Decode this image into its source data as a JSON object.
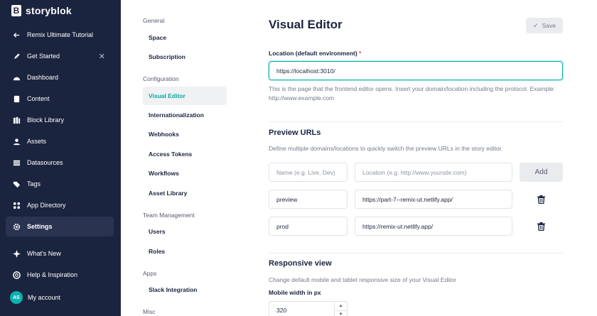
{
  "brand": {
    "logo_letter": "B",
    "name": "storyblok"
  },
  "sidebar": {
    "back_label": "Remix Ultimate Tutorial",
    "get_started": "Get Started",
    "items": [
      {
        "label": "Dashboard",
        "icon": "dashboard-icon"
      },
      {
        "label": "Content",
        "icon": "content-icon"
      },
      {
        "label": "Block Library",
        "icon": "block-library-icon"
      },
      {
        "label": "Assets",
        "icon": "assets-icon"
      },
      {
        "label": "Datasources",
        "icon": "datasources-icon"
      },
      {
        "label": "Tags",
        "icon": "tag-icon"
      },
      {
        "label": "App Directory",
        "icon": "app-directory-icon"
      },
      {
        "label": "Settings",
        "icon": "gear-icon"
      }
    ],
    "whats_new": "What's New",
    "help": "Help & Inspiration",
    "account": {
      "initials": "AS",
      "label": "My account"
    }
  },
  "subnav": {
    "general": "General",
    "general_items": [
      "Space",
      "Subscription"
    ],
    "configuration": "Configuration",
    "config_items": [
      "Visual Editor",
      "Internationalization",
      "Webhooks",
      "Access Tokens",
      "Workflows",
      "Asset Library"
    ],
    "team": "Team Management",
    "team_items": [
      "Users",
      "Roles"
    ],
    "apps": "Apps",
    "apps_items": [
      "Slack Integration"
    ],
    "misc": "Misc"
  },
  "main": {
    "title": "Visual Editor",
    "save_label": "Save",
    "location_label": "Location (default environment)",
    "location_required": "*",
    "location_value": "https://localhost:3010/",
    "location_help": "This is the page that the frontend editor opens. Insert your domain/location including the protocol. Example: http://www.example.com",
    "preview_title": "Preview URLs",
    "preview_desc": "Define multiple domains/locations to quickly switch the preview URLs in the story editor.",
    "name_placeholder": "Name (e.g. Live, Dev)",
    "location_placeholder": "Location (e.g. http://www.yoursite.com)",
    "add_label": "Add",
    "preview_rows": [
      {
        "name": "preview",
        "url": "https://part-7--remix-ut.netlify.app/"
      },
      {
        "name": "prod",
        "url": "https://remix-ut.netlify.app/"
      }
    ],
    "responsive_title": "Responsive view",
    "responsive_desc": "Change default mobile and tablet responsive size of your Visual Editor",
    "mobile_width_label": "Mobile width in px",
    "mobile_width_value": "320"
  },
  "colors": {
    "sidebar_bg": "#1b243f",
    "accent": "#09b3af",
    "required": "#e7475a"
  }
}
